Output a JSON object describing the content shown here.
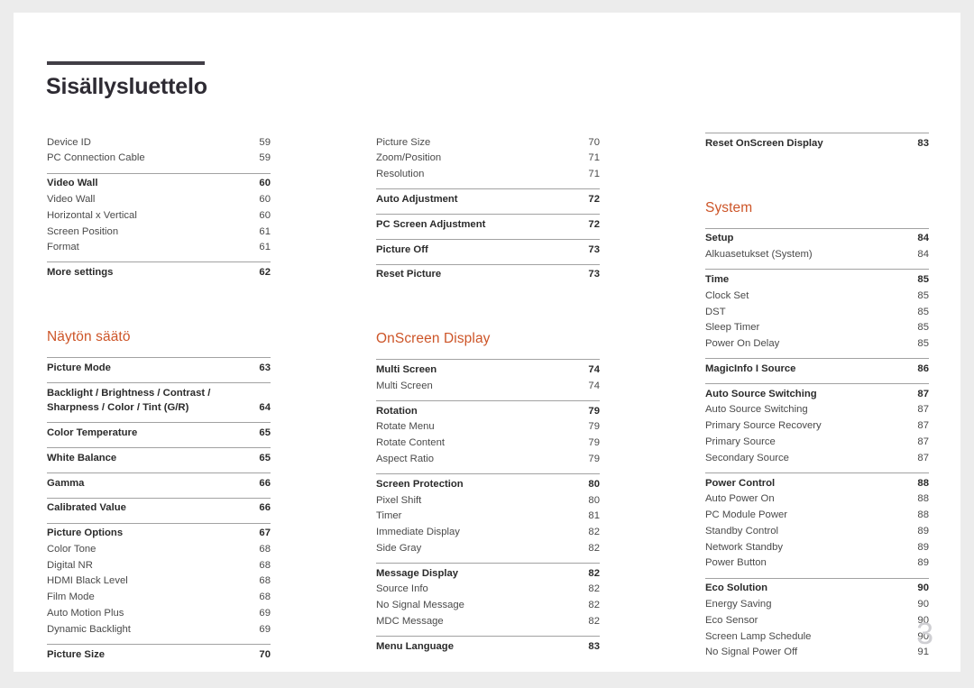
{
  "document": {
    "title": "Sisällysluettelo",
    "folio": "3",
    "accent_color": "#cd5528",
    "rule_color": "#a2a2a2",
    "title_bar_color": "#413e46"
  },
  "columns": [
    {
      "name": "column-1",
      "blocks": [
        {
          "type": "group",
          "rule": false,
          "rows": [
            {
              "label": "Device ID",
              "page": "59",
              "bold": false
            },
            {
              "label": "PC Connection Cable",
              "page": "59",
              "bold": false
            }
          ]
        },
        {
          "type": "group",
          "rule": true,
          "rows": [
            {
              "label": "Video Wall",
              "page": "60",
              "bold": true
            },
            {
              "label": "Video Wall",
              "page": "60",
              "bold": false
            },
            {
              "label": "Horizontal x Vertical",
              "page": "60",
              "bold": false
            },
            {
              "label": "Screen Position",
              "page": "61",
              "bold": false
            },
            {
              "label": "Format",
              "page": "61",
              "bold": false
            }
          ]
        },
        {
          "type": "group",
          "rule": true,
          "rows": [
            {
              "label": "More settings",
              "page": "62",
              "bold": true
            }
          ]
        },
        {
          "type": "heading",
          "label": "Näytön säätö"
        },
        {
          "type": "group",
          "rule": true,
          "rows": [
            {
              "label": "Picture Mode",
              "page": "63",
              "bold": true
            }
          ]
        },
        {
          "type": "group",
          "rule": true,
          "rows": [
            {
              "label": "Backlight / Brightness / Contrast /\nSharpness / Color / Tint (G/R)",
              "page": "64",
              "bold": true
            }
          ]
        },
        {
          "type": "group",
          "rule": true,
          "rows": [
            {
              "label": "Color Temperature",
              "page": "65",
              "bold": true
            }
          ]
        },
        {
          "type": "group",
          "rule": true,
          "rows": [
            {
              "label": "White Balance",
              "page": "65",
              "bold": true
            }
          ]
        },
        {
          "type": "group",
          "rule": true,
          "rows": [
            {
              "label": "Gamma",
              "page": "66",
              "bold": true
            }
          ]
        },
        {
          "type": "group",
          "rule": true,
          "rows": [
            {
              "label": "Calibrated Value",
              "page": "66",
              "bold": true
            }
          ]
        },
        {
          "type": "group",
          "rule": true,
          "rows": [
            {
              "label": "Picture Options",
              "page": "67",
              "bold": true
            },
            {
              "label": "Color Tone",
              "page": "68",
              "bold": false
            },
            {
              "label": "Digital NR",
              "page": "68",
              "bold": false
            },
            {
              "label": "HDMI Black Level",
              "page": "68",
              "bold": false
            },
            {
              "label": "Film Mode",
              "page": "68",
              "bold": false
            },
            {
              "label": "Auto Motion Plus",
              "page": "69",
              "bold": false
            },
            {
              "label": "Dynamic Backlight",
              "page": "69",
              "bold": false
            }
          ]
        },
        {
          "type": "group",
          "rule": true,
          "rows": [
            {
              "label": "Picture Size",
              "page": "70",
              "bold": true
            }
          ]
        }
      ]
    },
    {
      "name": "column-2",
      "blocks": [
        {
          "type": "group",
          "rule": false,
          "rows": [
            {
              "label": "Picture Size",
              "page": "70",
              "bold": false
            },
            {
              "label": "Zoom/Position",
              "page": "71",
              "bold": false
            },
            {
              "label": "Resolution",
              "page": "71",
              "bold": false
            }
          ]
        },
        {
          "type": "group",
          "rule": true,
          "rows": [
            {
              "label": "Auto Adjustment",
              "page": "72",
              "bold": true
            }
          ]
        },
        {
          "type": "group",
          "rule": true,
          "rows": [
            {
              "label": "PC Screen Adjustment",
              "page": "72",
              "bold": true
            }
          ]
        },
        {
          "type": "group",
          "rule": true,
          "rows": [
            {
              "label": "Picture Off",
              "page": "73",
              "bold": true
            }
          ]
        },
        {
          "type": "group",
          "rule": true,
          "rows": [
            {
              "label": "Reset Picture",
              "page": "73",
              "bold": true
            }
          ]
        },
        {
          "type": "heading",
          "label": "OnScreen Display"
        },
        {
          "type": "group",
          "rule": true,
          "rows": [
            {
              "label": "Multi Screen",
              "page": "74",
              "bold": true
            },
            {
              "label": "Multi Screen",
              "page": "74",
              "bold": false
            }
          ]
        },
        {
          "type": "group",
          "rule": true,
          "rows": [
            {
              "label": "Rotation",
              "page": "79",
              "bold": true
            },
            {
              "label": "Rotate Menu",
              "page": "79",
              "bold": false
            },
            {
              "label": "Rotate Content",
              "page": "79",
              "bold": false
            },
            {
              "label": "Aspect Ratio",
              "page": "79",
              "bold": false
            }
          ]
        },
        {
          "type": "group",
          "rule": true,
          "rows": [
            {
              "label": "Screen Protection",
              "page": "80",
              "bold": true
            },
            {
              "label": "Pixel Shift",
              "page": "80",
              "bold": false
            },
            {
              "label": "Timer",
              "page": "81",
              "bold": false
            },
            {
              "label": "Immediate Display",
              "page": "82",
              "bold": false
            },
            {
              "label": "Side Gray",
              "page": "82",
              "bold": false
            }
          ]
        },
        {
          "type": "group",
          "rule": true,
          "rows": [
            {
              "label": "Message Display",
              "page": "82",
              "bold": true
            },
            {
              "label": "Source Info",
              "page": "82",
              "bold": false
            },
            {
              "label": "No Signal Message",
              "page": "82",
              "bold": false
            },
            {
              "label": "MDC Message",
              "page": "82",
              "bold": false
            }
          ]
        },
        {
          "type": "group",
          "rule": true,
          "rows": [
            {
              "label": "Menu Language",
              "page": "83",
              "bold": true
            }
          ]
        }
      ]
    },
    {
      "name": "column-3",
      "blocks": [
        {
          "type": "group",
          "rule": true,
          "rows": [
            {
              "label": "Reset OnScreen Display",
              "page": "83",
              "bold": true
            }
          ]
        },
        {
          "type": "heading",
          "label": "System"
        },
        {
          "type": "group",
          "rule": true,
          "rows": [
            {
              "label": "Setup",
              "page": "84",
              "bold": true
            },
            {
              "label": "Alkuasetukset (System)",
              "page": "84",
              "bold": false
            }
          ]
        },
        {
          "type": "group",
          "rule": true,
          "rows": [
            {
              "label": "Time",
              "page": "85",
              "bold": true
            },
            {
              "label": "Clock Set",
              "page": "85",
              "bold": false
            },
            {
              "label": "DST",
              "page": "85",
              "bold": false
            },
            {
              "label": "Sleep Timer",
              "page": "85",
              "bold": false
            },
            {
              "label": "Power On Delay",
              "page": "85",
              "bold": false
            }
          ]
        },
        {
          "type": "group",
          "rule": true,
          "rows": [
            {
              "label": "MagicInfo I Source",
              "page": "86",
              "bold": true
            }
          ]
        },
        {
          "type": "group",
          "rule": true,
          "rows": [
            {
              "label": "Auto Source Switching",
              "page": "87",
              "bold": true
            },
            {
              "label": "Auto Source Switching",
              "page": "87",
              "bold": false
            },
            {
              "label": "Primary Source Recovery",
              "page": "87",
              "bold": false
            },
            {
              "label": "Primary Source",
              "page": "87",
              "bold": false
            },
            {
              "label": "Secondary Source",
              "page": "87",
              "bold": false
            }
          ]
        },
        {
          "type": "group",
          "rule": true,
          "rows": [
            {
              "label": "Power Control",
              "page": "88",
              "bold": true
            },
            {
              "label": "Auto Power On",
              "page": "88",
              "bold": false
            },
            {
              "label": "PC Module Power",
              "page": "88",
              "bold": false
            },
            {
              "label": "Standby Control",
              "page": "89",
              "bold": false
            },
            {
              "label": "Network Standby",
              "page": "89",
              "bold": false
            },
            {
              "label": "Power Button",
              "page": "89",
              "bold": false
            }
          ]
        },
        {
          "type": "group",
          "rule": true,
          "rows": [
            {
              "label": "Eco Solution",
              "page": "90",
              "bold": true
            },
            {
              "label": "Energy Saving",
              "page": "90",
              "bold": false
            },
            {
              "label": "Eco Sensor",
              "page": "90",
              "bold": false
            },
            {
              "label": "Screen Lamp Schedule",
              "page": "90",
              "bold": false
            },
            {
              "label": "No Signal Power Off",
              "page": "91",
              "bold": false
            }
          ]
        }
      ]
    }
  ]
}
